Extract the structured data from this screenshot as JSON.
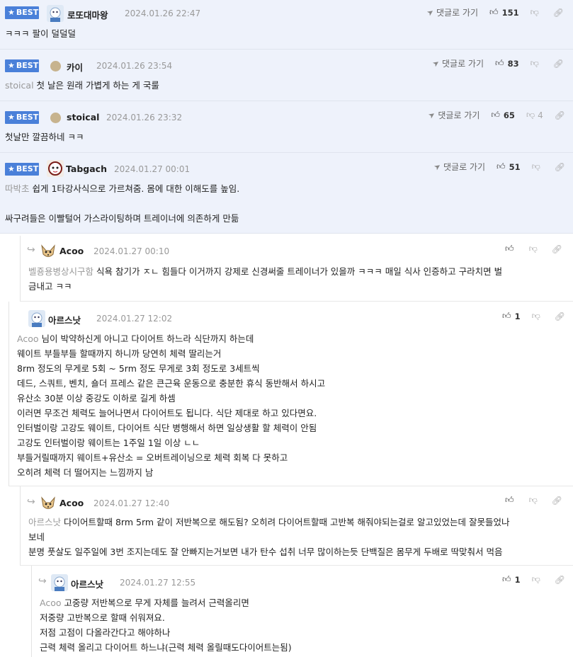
{
  "badge_label": "BEST",
  "goto_label": "댓글로 가기",
  "best_comments": [
    {
      "nick": "로또대마왕",
      "date": "2024.01.26 22:47",
      "likes": "151",
      "dislikes": "",
      "mention": "",
      "lines": [
        "ㅋㅋㅋ 팔이 덜덜덜"
      ]
    },
    {
      "nick": "카이",
      "date": "2024.01.26 23:54",
      "likes": "83",
      "dislikes": "",
      "mention": "stoical",
      "lines": [
        "첫 날은 원래 가볍게 하는 게 국룰"
      ]
    },
    {
      "nick": "stoical",
      "date": "2024.01.26 23:32",
      "likes": "65",
      "dislikes": "4",
      "mention": "",
      "lines": [
        "첫날만 깔끔하네 ㅋㅋ"
      ]
    },
    {
      "nick": "Tabgach",
      "date": "2024.01.27 00:01",
      "likes": "51",
      "dislikes": "",
      "mention": "따박초",
      "lines": [
        "쉽게 1타강사식으로 가르쳐줌. 몸에 대한 이해도를 높임.",
        "",
        "싸구려들은 이빨털어 가스라이팅하며 트레이너에 의존하게 만듦"
      ]
    }
  ],
  "replies": [
    {
      "nick": "Acoo",
      "date": "2024.01.27 00:10",
      "likes": "",
      "mention": "벨죵용병상시구함",
      "lines": [
        "식욕 참기가 ㅈㄴ 힘들다 이거까지 강제로 신경써줄 트레이너가 있을까 ㅋㅋㅋ 매일 식사 인증하고 구라치면 벌",
        "금내고 ㅋㅋ"
      ]
    },
    {
      "nick": "아르스낫",
      "date": "2024.01.27 12:02",
      "likes": "1",
      "mention": "Acoo",
      "lines": [
        "님이 박약하신게 아니고 다이어트 하느라 식단까지 하는데",
        "웨이트 부들부들 할때까지 하니까 당연히 체력 딸리는거",
        "8rm 정도의 무게로 5회 ~ 5rm 정도 무게로 3회 정도로 3세트씩",
        "데드, 스쿼트, 벤치, 숄더 프레스 같은 큰근육 운동으로 충분한 휴식 동반해서 하시고",
        "유산소 30분 이상 중강도 이하로 길게 하셈",
        "이러면 무조건 체력도 늘어나면서 다이어트도 됩니다. 식단 제대로 하고 있다면요.",
        "인터벌이랑 고강도 웨이트, 다이어트 식단 병행해서 하면 일상생활 할 체력이 안됨",
        "고강도 인터벌이랑 웨이트는 1주일 1일 이상 ㄴㄴ",
        "부들거릴때까지 웨이트+유산소 = 오버트레이닝으로 체력 회복 다 못하고",
        "오히려 체력 더 떨어지는 느낌까지 남"
      ]
    },
    {
      "nick": "Acoo",
      "date": "2024.01.27 12:40",
      "likes": "",
      "mention": "아르스낫",
      "lines": [
        "다이어트할때 8rm 5rm 같이 저반복으로 해도됨? 오히려 다이어트할때 고반복 해줘야되는걸로 알고있었는데 잘못들었나",
        "보네",
        "분명 풋살도 일주일에 3번 조지는데도 잘 안빠지는거보면 내가 탄수 섭취 너무 많이하는듯 단백질은 몸무게 두배로 딱맞춰서 먹음"
      ]
    },
    {
      "nick": "아르스낫",
      "date": "2024.01.27 12:55",
      "likes": "1",
      "mention": "Acoo",
      "lines": [
        "고중량 저반복으로 무게 자체를 늘려서 근력올리면",
        "저중량 고반복으로 할때 쉬워져요.",
        "저점 고점이 다올라간다고 해야하나",
        "근력 체력 올리고 다이어트 하느냐(근력 체력 올릴때도다이어트는됨)"
      ]
    }
  ]
}
